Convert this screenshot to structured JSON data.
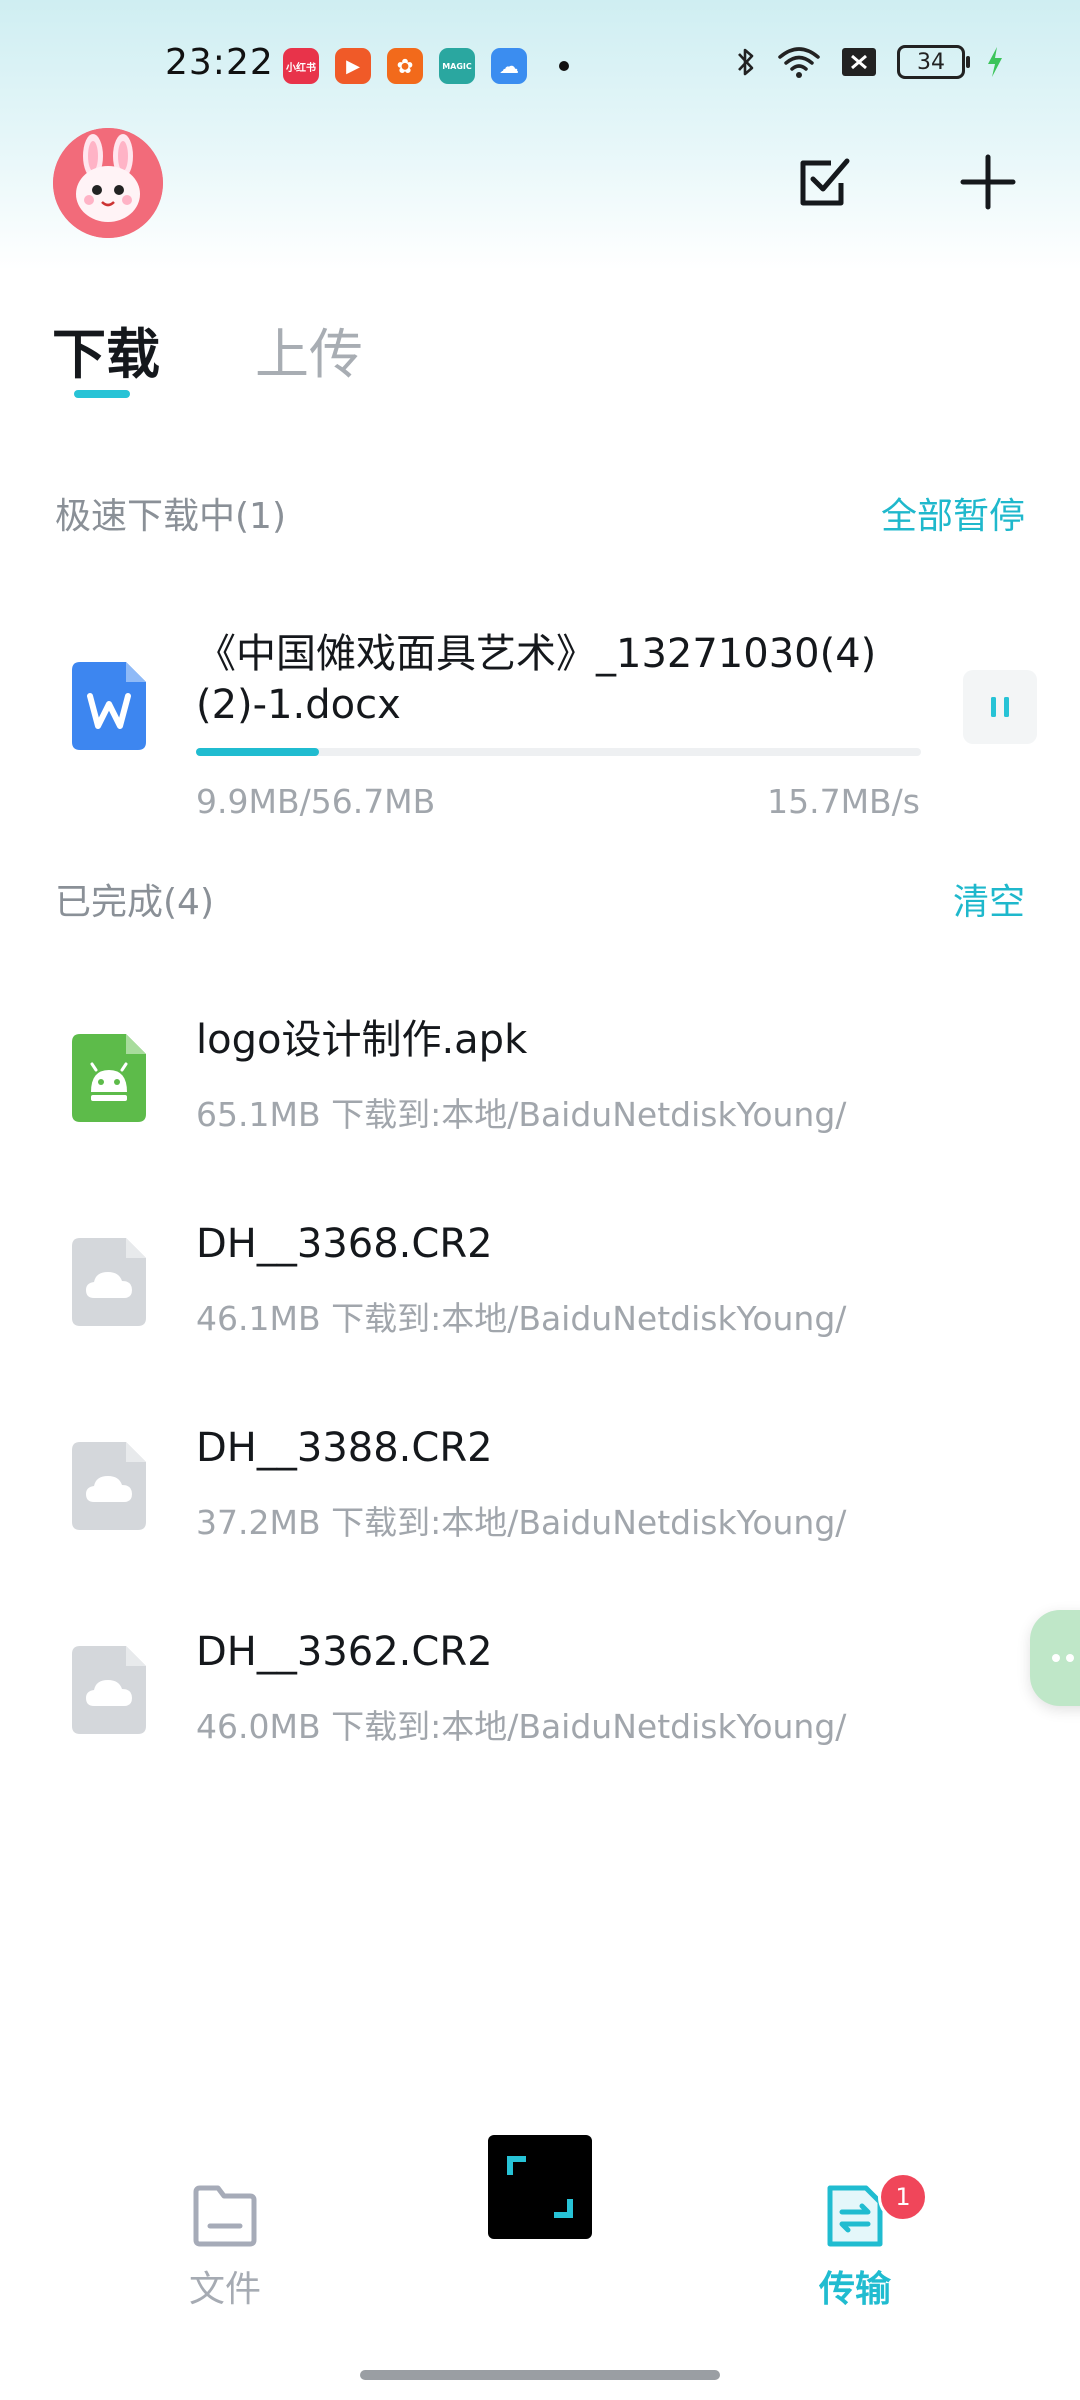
{
  "status_bar": {
    "time": "23:22",
    "battery": "34",
    "app_icons": [
      {
        "name": "xiaohongshu-icon",
        "label": "小红书",
        "color": "#e8334a"
      },
      {
        "name": "video-app-icon",
        "label": "▶",
        "color": "#f05a28"
      },
      {
        "name": "kuaishou-icon",
        "label": "✿",
        "color": "#f26a1b"
      },
      {
        "name": "magic-app-icon",
        "label": "MAGIC",
        "color": "#2aa7a0"
      },
      {
        "name": "weather-icon",
        "label": "☁",
        "color": "#3b8df0"
      }
    ]
  },
  "tabs": [
    {
      "label": "下载"
    },
    {
      "label": "上传"
    }
  ],
  "downloading": {
    "title": "极速下载中(1)",
    "action": "全部暂停",
    "item": {
      "name_line1": "《中国傩戏面具艺术》_13271030(4)",
      "name_line2": "(2)-1.docx",
      "size": "9.9MB/56.7MB",
      "speed": "15.7MB/s",
      "progress": 0.17
    }
  },
  "completed": {
    "title": "已完成(4)",
    "action": "清空",
    "items": [
      {
        "name": "logo设计制作.apk",
        "meta": "65.1MB 下载到:本地/BaiduNetdiskYoung/",
        "type": "apk"
      },
      {
        "name": "DH__3368.CR2",
        "meta": "46.1MB 下载到:本地/BaiduNetdiskYoung/",
        "type": "raw"
      },
      {
        "name": "DH__3388.CR2",
        "meta": "37.2MB 下载到:本地/BaiduNetdiskYoung/",
        "type": "raw"
      },
      {
        "name": "DH__3362.CR2",
        "meta": "46.0MB 下载到:本地/BaiduNetdiskYoung/",
        "type": "raw"
      }
    ]
  },
  "bottom_nav": {
    "files_label": "文件",
    "transfer_label": "传输",
    "transfer_badge": "1"
  },
  "colors": {
    "accent": "#20bcd0",
    "badge": "#f0465a"
  }
}
